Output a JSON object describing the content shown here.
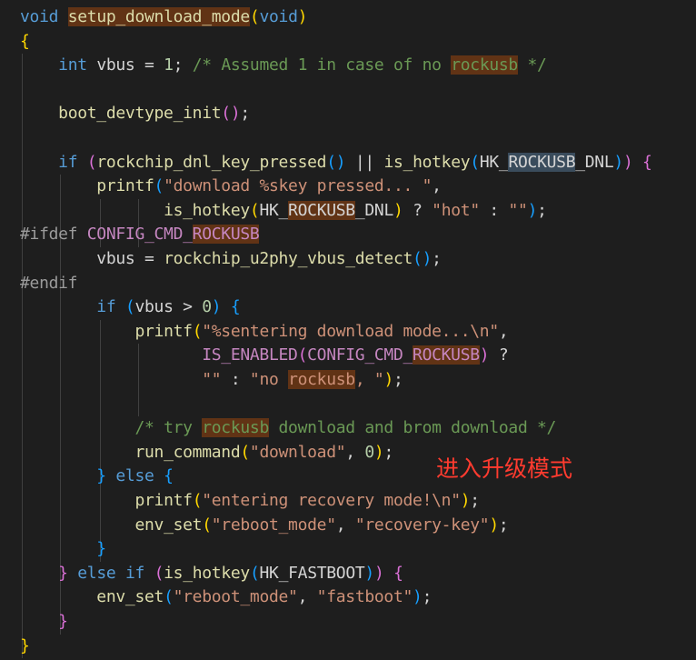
{
  "lines": [
    [
      {
        "t": "void",
        "c": "kw"
      },
      {
        "t": " ",
        "c": "plain"
      },
      {
        "t": "setup_download_mode",
        "c": "fn",
        "h": 1
      },
      {
        "t": "(",
        "c": "b1"
      },
      {
        "t": "void",
        "c": "kw"
      },
      {
        "t": ")",
        "c": "b1"
      }
    ],
    [
      {
        "t": "{",
        "c": "b1"
      }
    ],
    [
      {
        "t": "    ",
        "c": "plain"
      },
      {
        "t": "int",
        "c": "kw"
      },
      {
        "t": " vbus = ",
        "c": "plain"
      },
      {
        "t": "1",
        "c": "num"
      },
      {
        "t": "; ",
        "c": "plain"
      },
      {
        "t": "/* Assumed 1 in case of no ",
        "c": "cm"
      },
      {
        "t": "rockusb",
        "c": "cm",
        "h": 1
      },
      {
        "t": " */",
        "c": "cm"
      }
    ],
    [],
    [
      {
        "t": "    ",
        "c": "plain"
      },
      {
        "t": "boot_devtype_init",
        "c": "fn"
      },
      {
        "t": "()",
        "c": "b2"
      },
      {
        "t": ";",
        "c": "plain"
      }
    ],
    [],
    [
      {
        "t": "    ",
        "c": "plain"
      },
      {
        "t": "if",
        "c": "kw"
      },
      {
        "t": " ",
        "c": "plain"
      },
      {
        "t": "(",
        "c": "b2"
      },
      {
        "t": "rockchip_dnl_key_pressed",
        "c": "fn"
      },
      {
        "t": "()",
        "c": "b3"
      },
      {
        "t": " || ",
        "c": "plain"
      },
      {
        "t": "is_hotkey",
        "c": "fn"
      },
      {
        "t": "(",
        "c": "b3"
      },
      {
        "t": "HK_",
        "c": "plain"
      },
      {
        "t": "ROCKUSB",
        "c": "plain",
        "h": 2
      },
      {
        "t": "_DNL",
        "c": "plain"
      },
      {
        "t": ")",
        "c": "b3"
      },
      {
        "t": ")",
        "c": "b2"
      },
      {
        "t": " ",
        "c": "plain"
      },
      {
        "t": "{",
        "c": "b2"
      }
    ],
    [
      {
        "t": "        ",
        "c": "plain"
      },
      {
        "t": "printf",
        "c": "fn"
      },
      {
        "t": "(",
        "c": "b3"
      },
      {
        "t": "\"download %skey pressed... \"",
        "c": "str"
      },
      {
        "t": ",",
        "c": "plain"
      }
    ],
    [
      {
        "t": "               ",
        "c": "plain"
      },
      {
        "t": "is_hotkey",
        "c": "fn"
      },
      {
        "t": "(",
        "c": "b1"
      },
      {
        "t": "HK_",
        "c": "plain"
      },
      {
        "t": "ROCKUSB",
        "c": "plain",
        "h": 1
      },
      {
        "t": "_DNL",
        "c": "plain"
      },
      {
        "t": ")",
        "c": "b1"
      },
      {
        "t": " ? ",
        "c": "plain"
      },
      {
        "t": "\"hot\"",
        "c": "str"
      },
      {
        "t": " : ",
        "c": "plain"
      },
      {
        "t": "\"\"",
        "c": "str"
      },
      {
        "t": ")",
        "c": "b3"
      },
      {
        "t": ";",
        "c": "plain"
      }
    ],
    [
      {
        "t": "#ifdef ",
        "c": "pp"
      },
      {
        "t": "CONFIG_CMD_",
        "c": "macro"
      },
      {
        "t": "ROCKUSB",
        "c": "macro",
        "h": 1
      }
    ],
    [
      {
        "t": "        ",
        "c": "plain"
      },
      {
        "t": "vbus = ",
        "c": "plain"
      },
      {
        "t": "rockchip_u2phy_vbus_detect",
        "c": "fn"
      },
      {
        "t": "()",
        "c": "b3"
      },
      {
        "t": ";",
        "c": "plain"
      }
    ],
    [
      {
        "t": "#endif",
        "c": "pp"
      }
    ],
    [
      {
        "t": "        ",
        "c": "plain"
      },
      {
        "t": "if",
        "c": "kw"
      },
      {
        "t": " ",
        "c": "plain"
      },
      {
        "t": "(",
        "c": "b3"
      },
      {
        "t": "vbus > ",
        "c": "plain"
      },
      {
        "t": "0",
        "c": "num"
      },
      {
        "t": ")",
        "c": "b3"
      },
      {
        "t": " ",
        "c": "plain"
      },
      {
        "t": "{",
        "c": "b3"
      }
    ],
    [
      {
        "t": "            ",
        "c": "plain"
      },
      {
        "t": "printf",
        "c": "fn"
      },
      {
        "t": "(",
        "c": "b1"
      },
      {
        "t": "\"%sentering download mode...\\n\"",
        "c": "str"
      },
      {
        "t": ",",
        "c": "plain"
      }
    ],
    [
      {
        "t": "                   ",
        "c": "plain"
      },
      {
        "t": "IS_ENABLED",
        "c": "macro"
      },
      {
        "t": "(",
        "c": "b2"
      },
      {
        "t": "CONFIG_CMD_",
        "c": "macro"
      },
      {
        "t": "ROCKUSB",
        "c": "macro",
        "h": 1
      },
      {
        "t": ")",
        "c": "b2"
      },
      {
        "t": " ?",
        "c": "plain"
      }
    ],
    [
      {
        "t": "                   ",
        "c": "plain"
      },
      {
        "t": "\"\"",
        "c": "str"
      },
      {
        "t": " : ",
        "c": "plain"
      },
      {
        "t": "\"no ",
        "c": "str"
      },
      {
        "t": "rockusb",
        "c": "str",
        "h": 1
      },
      {
        "t": ", \"",
        "c": "str"
      },
      {
        "t": ")",
        "c": "b1"
      },
      {
        "t": ";",
        "c": "plain"
      }
    ],
    [],
    [
      {
        "t": "            ",
        "c": "plain"
      },
      {
        "t": "/* try ",
        "c": "cm"
      },
      {
        "t": "rockusb",
        "c": "cm",
        "h": 1
      },
      {
        "t": " download and brom download */",
        "c": "cm"
      }
    ],
    [
      {
        "t": "            ",
        "c": "plain"
      },
      {
        "t": "run_command",
        "c": "fn"
      },
      {
        "t": "(",
        "c": "b1"
      },
      {
        "t": "\"download\"",
        "c": "str"
      },
      {
        "t": ", ",
        "c": "plain"
      },
      {
        "t": "0",
        "c": "num"
      },
      {
        "t": ")",
        "c": "b1"
      },
      {
        "t": ";",
        "c": "plain"
      }
    ],
    [
      {
        "t": "        ",
        "c": "plain"
      },
      {
        "t": "}",
        "c": "b3"
      },
      {
        "t": " ",
        "c": "plain"
      },
      {
        "t": "else",
        "c": "kw"
      },
      {
        "t": " ",
        "c": "plain"
      },
      {
        "t": "{",
        "c": "b3"
      }
    ],
    [
      {
        "t": "            ",
        "c": "plain"
      },
      {
        "t": "printf",
        "c": "fn"
      },
      {
        "t": "(",
        "c": "b1"
      },
      {
        "t": "\"entering recovery mode!\\n\"",
        "c": "str"
      },
      {
        "t": ")",
        "c": "b1"
      },
      {
        "t": ";",
        "c": "plain"
      }
    ],
    [
      {
        "t": "            ",
        "c": "plain"
      },
      {
        "t": "env_set",
        "c": "fn"
      },
      {
        "t": "(",
        "c": "b1"
      },
      {
        "t": "\"reboot_mode\"",
        "c": "str"
      },
      {
        "t": ", ",
        "c": "plain"
      },
      {
        "t": "\"recovery-key\"",
        "c": "str"
      },
      {
        "t": ")",
        "c": "b1"
      },
      {
        "t": ";",
        "c": "plain"
      }
    ],
    [
      {
        "t": "        ",
        "c": "plain"
      },
      {
        "t": "}",
        "c": "b3"
      }
    ],
    [
      {
        "t": "    ",
        "c": "plain"
      },
      {
        "t": "}",
        "c": "b2"
      },
      {
        "t": " ",
        "c": "plain"
      },
      {
        "t": "else",
        "c": "kw"
      },
      {
        "t": " ",
        "c": "plain"
      },
      {
        "t": "if",
        "c": "kw"
      },
      {
        "t": " ",
        "c": "plain"
      },
      {
        "t": "(",
        "c": "b2"
      },
      {
        "t": "is_hotkey",
        "c": "fn"
      },
      {
        "t": "(",
        "c": "b3"
      },
      {
        "t": "HK_FASTBOOT",
        "c": "plain"
      },
      {
        "t": ")",
        "c": "b3"
      },
      {
        "t": ")",
        "c": "b2"
      },
      {
        "t": " ",
        "c": "plain"
      },
      {
        "t": "{",
        "c": "b2"
      }
    ],
    [
      {
        "t": "        ",
        "c": "plain"
      },
      {
        "t": "env_set",
        "c": "fn"
      },
      {
        "t": "(",
        "c": "b3"
      },
      {
        "t": "\"reboot_mode\"",
        "c": "str"
      },
      {
        "t": ", ",
        "c": "plain"
      },
      {
        "t": "\"fastboot\"",
        "c": "str"
      },
      {
        "t": ")",
        "c": "b3"
      },
      {
        "t": ";",
        "c": "plain"
      }
    ],
    [
      {
        "t": "    ",
        "c": "plain"
      },
      {
        "t": "}",
        "c": "b2"
      }
    ],
    [
      {
        "t": "}",
        "c": "b1"
      }
    ]
  ],
  "annotation": "进入升级模式"
}
